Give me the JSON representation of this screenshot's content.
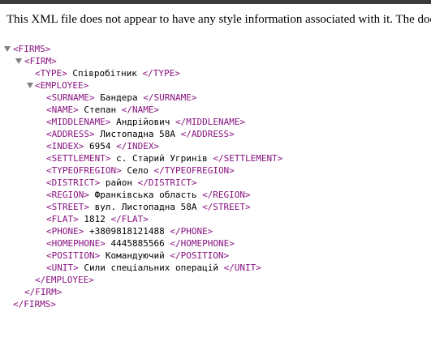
{
  "notice": "This XML file does not appear to have any style information associated with it. The document tree is shown below.",
  "firms_open": "<FIRMS>",
  "firm_open": "<FIRM>",
  "type": {
    "open": "<TYPE>",
    "value": " Співробітник ",
    "close": "</TYPE>"
  },
  "employee_open": "<EMPLOYEE>",
  "fields": [
    {
      "open": "<SURNAME>",
      "value": " Бандера ",
      "close": "</SURNAME>"
    },
    {
      "open": "<NAME>",
      "value": " Степан ",
      "close": "</NAME>"
    },
    {
      "open": "<MIDDLENAME>",
      "value": " Андрійович ",
      "close": "</MIDDLENAME>"
    },
    {
      "open": "<ADDRESS>",
      "value": " Листопадна 58А ",
      "close": "</ADDRESS>"
    },
    {
      "open": "<INDEX>",
      "value": " 6954 ",
      "close": "</INDEX>"
    },
    {
      "open": "<SETTLEMENT>",
      "value": " с. Старий Угринів ",
      "close": "</SETTLEMENT>"
    },
    {
      "open": "<TYPEOFREGION>",
      "value": " Село ",
      "close": "</TYPEOFREGION>"
    },
    {
      "open": "<DISTRICT>",
      "value": " район ",
      "close": "</DISTRICT>"
    },
    {
      "open": "<REGION>",
      "value": " Франківська область ",
      "close": "</REGION>"
    },
    {
      "open": "<STREET>",
      "value": " вул. Листопадна 58А ",
      "close": "</STREET>"
    },
    {
      "open": "<FLAT>",
      "value": " 1812 ",
      "close": "</FLAT>"
    },
    {
      "open": "<PHONE>",
      "value": " +3809818121488 ",
      "close": "</PHONE>"
    },
    {
      "open": "<HOMEPHONE>",
      "value": " 4445885566 ",
      "close": "</HOMEPHONE>"
    },
    {
      "open": "<POSITION>",
      "value": " Командуючий ",
      "close": "</POSITION>"
    },
    {
      "open": "<UNIT>",
      "value": " Сили спеціальних операцій ",
      "close": "</UNIT>"
    }
  ],
  "employee_close": "</EMPLOYEE>",
  "firm_close": "</FIRM>",
  "firms_close": "</FIRMS>"
}
